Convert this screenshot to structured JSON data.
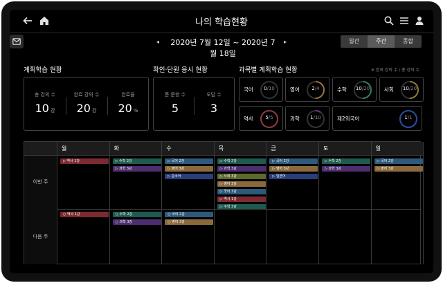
{
  "header": {
    "title": "나의 학습현황"
  },
  "nav": {
    "date_prev": "◂",
    "date_range": "2020년 7월 12일 ~ 2020년 7월 18일",
    "date_next": "▸",
    "views": [
      "일간",
      "주간",
      "종합"
    ],
    "active_view": "주간"
  },
  "plan": {
    "title": "계획학습 현황",
    "total_label": "총 강의 수",
    "total_value": "10",
    "total_unit": "강",
    "done_label": "완료 강의 수",
    "done_value": "20",
    "done_unit": "강",
    "rate_label": "완료율",
    "rate_value": "20",
    "rate_unit": "%"
  },
  "check": {
    "title": "확인·단원 응시 현황",
    "solved_label": "푼 문항 수",
    "solved_value": "5",
    "wrong_label": "오답 수",
    "wrong_value": "3"
  },
  "subjects": {
    "title": "과목별 계획학습 현황",
    "legend": "※ 완료 강의 수 / 총 강의 수",
    "items": [
      {
        "name": "국어",
        "done": "0",
        "total": "/10",
        "color": "#3a6a9a",
        "ratio": 0.0
      },
      {
        "name": "영어",
        "done": "2",
        "total": "/4",
        "color": "#9a7040",
        "ratio": 0.5
      },
      {
        "name": "수학",
        "done": "10",
        "total": "/20",
        "color": "#2f7a6a",
        "ratio": 0.5
      },
      {
        "name": "사회",
        "done": "10",
        "total": "/20",
        "color": "#8a7a3a",
        "ratio": 0.5
      },
      {
        "name": "역사",
        "done": "5",
        "total": "/5",
        "color": "#8a3a40",
        "ratio": 1.0
      },
      {
        "name": "과학",
        "done": "1",
        "total": "/10",
        "color": "#6a3a9a",
        "ratio": 0.1
      },
      {
        "name": "제2외국어",
        "done": "1",
        "total": "/1",
        "color": "#2a4aa0",
        "ratio": 1.0
      }
    ]
  },
  "schedule": {
    "days": [
      "월",
      "화",
      "수",
      "목",
      "금",
      "토",
      "일"
    ],
    "rows": [
      "이번 주",
      "다음 주"
    ],
    "this_week": [
      [
        {
          "label": "▷ 역사 1강",
          "cls": "c-hist"
        }
      ],
      [
        {
          "label": "▷ 수학 2강",
          "cls": "c-math"
        },
        {
          "label": "▷ 과학 3강",
          "cls": "c-sci"
        }
      ],
      [
        {
          "label": "▷ 국어 2강",
          "cls": "c-kor"
        },
        {
          "label": "▷ 영어 3강",
          "cls": "c-eng"
        },
        {
          "label": "▷ 중국어",
          "cls": "c-jpn"
        }
      ],
      [
        {
          "label": "▷ 수학 2강",
          "cls": "c-math"
        },
        {
          "label": "▷ 과학 3강",
          "cls": "c-sci"
        },
        {
          "label": "▷ 사회 3강",
          "cls": "c-soc"
        },
        {
          "label": "▷ 영어 3강",
          "cls": "c-eng"
        },
        {
          "label": "▷ 국어 3강",
          "cls": "c-kor"
        },
        {
          "label": "▷ 역사 1강",
          "cls": "c-hist"
        },
        {
          "label": "▷ 수학 3강",
          "cls": "c-math"
        }
      ],
      [
        {
          "label": "▷ 국어 2강",
          "cls": "c-kor"
        },
        {
          "label": "▷ 영어 3강",
          "cls": "c-eng"
        },
        {
          "label": "▷ 일본어",
          "cls": "c-jpn"
        }
      ],
      [
        {
          "label": "▷ 수학 2강",
          "cls": "c-math"
        },
        {
          "label": "▷ 과학 3강",
          "cls": "c-sci"
        }
      ],
      [
        {
          "label": "▷ 국어 2강",
          "cls": "c-kor"
        },
        {
          "label": "▷ 영어 3강",
          "cls": "c-eng"
        }
      ]
    ],
    "next_week": [
      [
        {
          "label": "○ 역사 1강",
          "cls": "c-hist"
        }
      ],
      [
        {
          "label": "○ 수학 2강",
          "cls": "c-math"
        },
        {
          "label": "○ 과학 3강",
          "cls": "c-sci"
        }
      ],
      [
        {
          "label": "○ 국어 2강",
          "cls": "c-kor"
        },
        {
          "label": "○ 영어 3강",
          "cls": "c-eng"
        }
      ],
      [],
      [],
      [],
      []
    ]
  }
}
